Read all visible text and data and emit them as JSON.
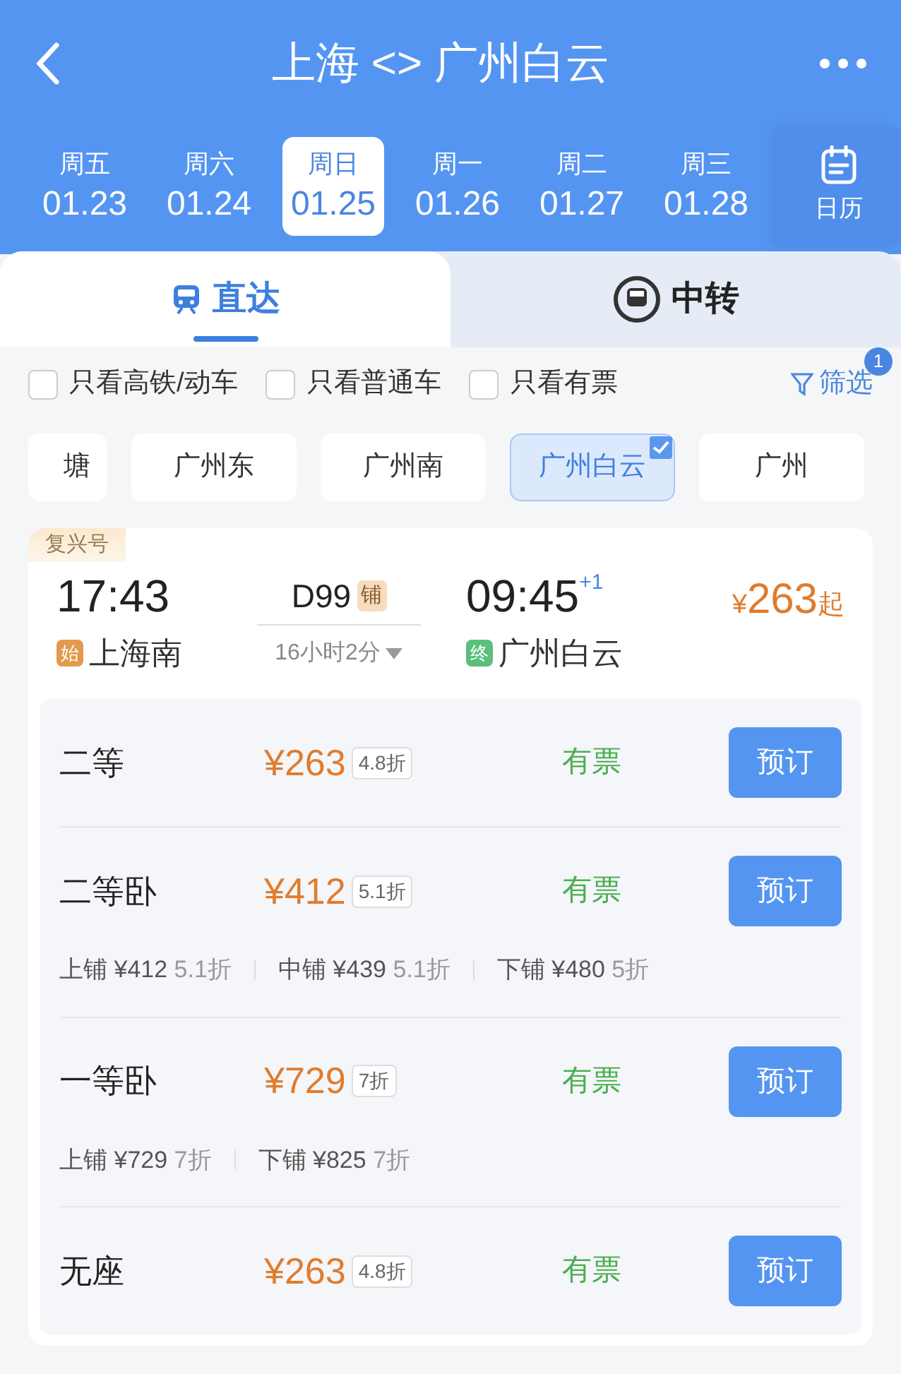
{
  "header": {
    "title": "上海 <> 广州白云"
  },
  "dates": [
    {
      "weekday": "周五",
      "date": "01.23",
      "selected": false
    },
    {
      "weekday": "周六",
      "date": "01.24",
      "selected": false
    },
    {
      "weekday": "周日",
      "date": "01.25",
      "selected": true
    },
    {
      "weekday": "周一",
      "date": "01.26",
      "selected": false
    },
    {
      "weekday": "周二",
      "date": "01.27",
      "selected": false
    },
    {
      "weekday": "周三",
      "date": "01.28",
      "selected": false
    }
  ],
  "calendar_label": "日历",
  "mode_tabs": [
    {
      "label": "直达",
      "selected": true
    },
    {
      "label": "中转",
      "selected": false
    }
  ],
  "filters": [
    {
      "label": "只看高铁/动车",
      "checked": false
    },
    {
      "label": "只看普通车",
      "checked": false
    },
    {
      "label": "只看有票",
      "checked": false
    }
  ],
  "filter_button": {
    "label": "筛选",
    "badge": "1"
  },
  "stations": [
    {
      "label": "塘",
      "selected": false
    },
    {
      "label": "广州东",
      "selected": false
    },
    {
      "label": "广州南",
      "selected": false
    },
    {
      "label": "广州白云",
      "selected": true
    },
    {
      "label": "广州",
      "selected": false
    }
  ],
  "train": {
    "type_tag": "复兴号",
    "depart_time": "17:43",
    "train_no": "D99",
    "berth_tag": "铺",
    "arrive_time": "09:45",
    "day_offset": "+1",
    "price_symbol": "¥",
    "price": "263",
    "price_suffix": "起",
    "origin_tag": "始",
    "origin": "上海南",
    "duration": "16小时2分",
    "terminal_tag": "终",
    "destination": "广州白云",
    "seats": [
      {
        "name": "二等",
        "price": "¥263",
        "discount": "4.8折",
        "status": "有票",
        "button": "预订"
      },
      {
        "name": "二等卧",
        "price": "¥412",
        "discount": "5.1折",
        "status": "有票",
        "button": "预订",
        "berths": [
          {
            "name": "上铺",
            "price": "¥412",
            "discount": "5.1折"
          },
          {
            "name": "中铺",
            "price": "¥439",
            "discount": "5.1折"
          },
          {
            "name": "下铺",
            "price": "¥480",
            "discount": "5折"
          }
        ]
      },
      {
        "name": "一等卧",
        "price": "¥729",
        "discount": "7折",
        "status": "有票",
        "button": "预订",
        "berths": [
          {
            "name": "上铺",
            "price": "¥729",
            "discount": "7折"
          },
          {
            "name": "下铺",
            "price": "¥825",
            "discount": "7折"
          }
        ]
      },
      {
        "name": "无座",
        "price": "¥263",
        "discount": "4.8折",
        "status": "有票",
        "button": "预订"
      }
    ]
  }
}
